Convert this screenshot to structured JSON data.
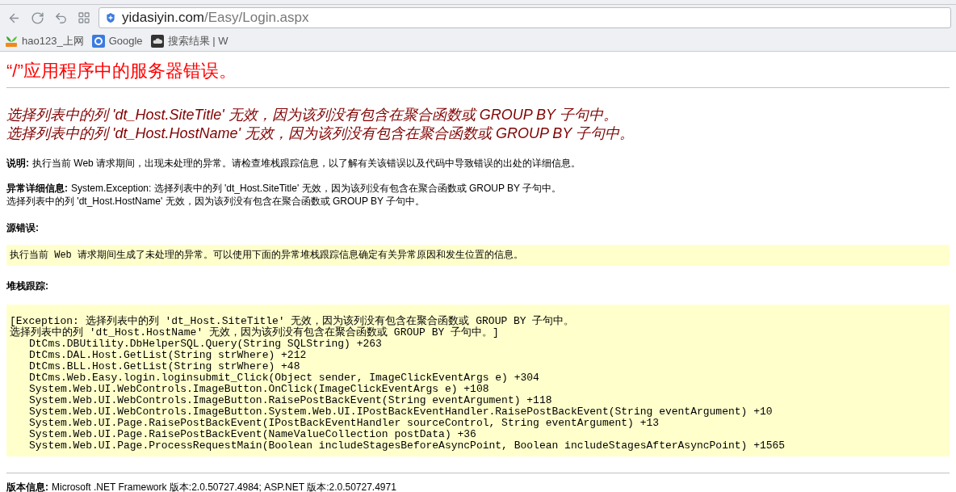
{
  "address_bar": {
    "domain": "yidasiyin.com",
    "path": "/Easy/Login.aspx"
  },
  "bookmarks": [
    {
      "kind": "hao",
      "label": "hao123_上网"
    },
    {
      "kind": "google",
      "label": "Google"
    },
    {
      "kind": "cloud",
      "label": "搜索结果 | W"
    }
  ],
  "page": {
    "title": "“/”应用程序中的服务器错误。",
    "error_messages": [
      "选择列表中的列 'dt_Host.SiteTitle' 无效，因为该列没有包含在聚合函数或 GROUP BY 子句中。",
      "选择列表中的列 'dt_Host.HostName' 无效，因为该列没有包含在聚合函数或 GROUP BY 子句中。"
    ],
    "description": {
      "label": "说明:",
      "text": "执行当前 Web 请求期间，出现未处理的异常。请检查堆栈跟踪信息，以了解有关该错误以及代码中导致错误的出处的详细信息。"
    },
    "exception_details": {
      "label": "异常详细信息:",
      "lines": [
        "System.Exception: 选择列表中的列 'dt_Host.SiteTitle' 无效，因为该列没有包含在聚合函数或 GROUP BY 子句中。",
        "选择列表中的列 'dt_Host.HostName' 无效，因为该列没有包含在聚合函数或 GROUP BY 子句中。"
      ]
    },
    "source_error": {
      "label": "源错误:",
      "text": "执行当前 Web 请求期间生成了未处理的异常。可以使用下面的异常堆栈跟踪信息确定有关异常原因和发生位置的信息。"
    },
    "stack_trace": {
      "label": "堆栈跟踪:",
      "header": [
        "[Exception: 选择列表中的列 'dt_Host.SiteTitle' 无效，因为该列没有包含在聚合函数或 GROUP BY 子句中。",
        "选择列表中的列 'dt_Host.HostName' 无效，因为该列没有包含在聚合函数或 GROUP BY 子句中。]"
      ],
      "frames": [
        "DtCms.DBUtility.DbHelperSQL.Query(String SQLString) +263",
        "DtCms.DAL.Host.GetList(String strWhere) +212",
        "DtCms.BLL.Host.GetList(String strWhere) +48",
        "DtCms.Web.Easy.login.loginsubmit_Click(Object sender, ImageClickEventArgs e) +304",
        "System.Web.UI.WebControls.ImageButton.OnClick(ImageClickEventArgs e) +108",
        "System.Web.UI.WebControls.ImageButton.RaisePostBackEvent(String eventArgument) +118",
        "System.Web.UI.WebControls.ImageButton.System.Web.UI.IPostBackEventHandler.RaisePostBackEvent(String eventArgument) +10",
        "System.Web.UI.Page.RaisePostBackEvent(IPostBackEventHandler sourceControl, String eventArgument) +13",
        "System.Web.UI.Page.RaisePostBackEvent(NameValueCollection postData) +36",
        "System.Web.UI.Page.ProcessRequestMain(Boolean includeStagesBeforeAsyncPoint, Boolean includeStagesAfterAsyncPoint) +1565"
      ]
    },
    "version": {
      "label": "版本信息:",
      "text": "Microsoft .NET Framework 版本:2.0.50727.4984; ASP.NET 版本:2.0.50727.4971"
    }
  }
}
